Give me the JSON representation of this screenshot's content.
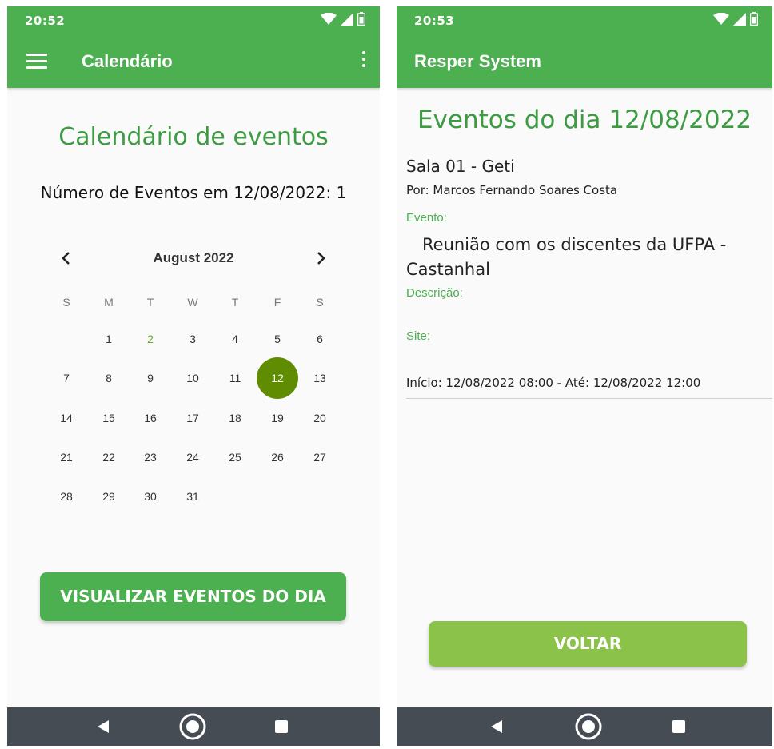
{
  "left": {
    "status_time": "20:52",
    "app_title": "Calendário",
    "heading": "Calendário de eventos",
    "count_text": "Número de Eventos em 12/08/2022: 1",
    "calendar": {
      "month_label": "August 2022",
      "weekdays": [
        "S",
        "M",
        "T",
        "W",
        "T",
        "F",
        "S"
      ],
      "days": [
        "1",
        "2",
        "3",
        "4",
        "5",
        "6",
        "7",
        "8",
        "9",
        "10",
        "11",
        "12",
        "13",
        "14",
        "15",
        "16",
        "17",
        "18",
        "19",
        "20",
        "21",
        "22",
        "23",
        "24",
        "25",
        "26",
        "27",
        "28",
        "29",
        "30",
        "31"
      ],
      "today": "2",
      "selected": "12"
    },
    "button_label": "VISUALIZAR EVENTOS DO DIA"
  },
  "right": {
    "status_time": "20:53",
    "app_title": "Resper System",
    "heading": "Eventos do dia 12/08/2022",
    "room": "Sala 01 - Geti",
    "author": "Por: Marcos Fernando Soares Costa",
    "event_label": "Evento:",
    "event_value": "Reunião com os discentes da UFPA - Castanhal",
    "description_label": "Descrição:",
    "site_label": "Site:",
    "time_range": "Início: 12/08/2022 08:00 - Até: 12/08/2022 12:00",
    "button_label": "VOLTAR"
  },
  "colors": {
    "primary": "#4caf50",
    "selected_day": "#5f8c00",
    "accent_button": "#8bc34a",
    "heading_text": "#3d9c43",
    "navbar": "#464c53"
  },
  "icons": [
    "wifi-icon",
    "signal-icon",
    "battery-icon",
    "menu-icon",
    "more-vert-icon",
    "chevron-left-icon",
    "chevron-right-icon",
    "nav-back-icon",
    "nav-home-icon",
    "nav-recents-icon"
  ]
}
